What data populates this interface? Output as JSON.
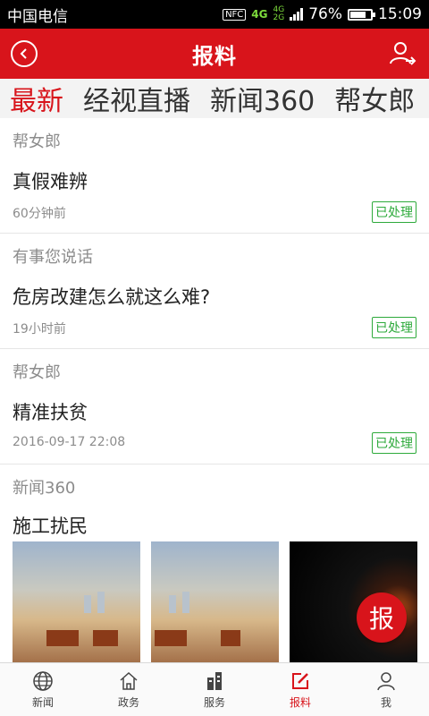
{
  "statusbar": {
    "carrier": "中国电信",
    "battery": "76%",
    "battery_level": 0.76,
    "time": "15:09",
    "nfc": "NFC",
    "net1": "4G",
    "net2a": "4G",
    "net2b": "2G"
  },
  "appbar": {
    "title": "报料"
  },
  "tabs": [
    "最新",
    "经视直播",
    "新闻360",
    "帮女郎"
  ],
  "items": [
    {
      "source": "帮女郎",
      "headline": "真假难辨",
      "time": "60分钟前",
      "badge": "已处理"
    },
    {
      "source": "有事您说话",
      "headline": "危房改建怎么就这么难?",
      "time": "19小时前",
      "badge": "已处理"
    },
    {
      "source": "帮女郎",
      "headline": "精准扶贫",
      "time": "2016-09-17 22:08",
      "badge": "已处理"
    },
    {
      "source": "新闻360",
      "headline": "施工扰民"
    }
  ],
  "fab": {
    "label": "报"
  },
  "bottomnav": [
    {
      "label": "新闻",
      "icon": "globe-icon"
    },
    {
      "label": "政务",
      "icon": "home-icon"
    },
    {
      "label": "服务",
      "icon": "building-icon"
    },
    {
      "label": "报料",
      "icon": "edit-icon"
    },
    {
      "label": "我",
      "icon": "person-icon"
    }
  ],
  "colors": {
    "brand": "#d8141b",
    "processed": "#2eaa3b"
  }
}
